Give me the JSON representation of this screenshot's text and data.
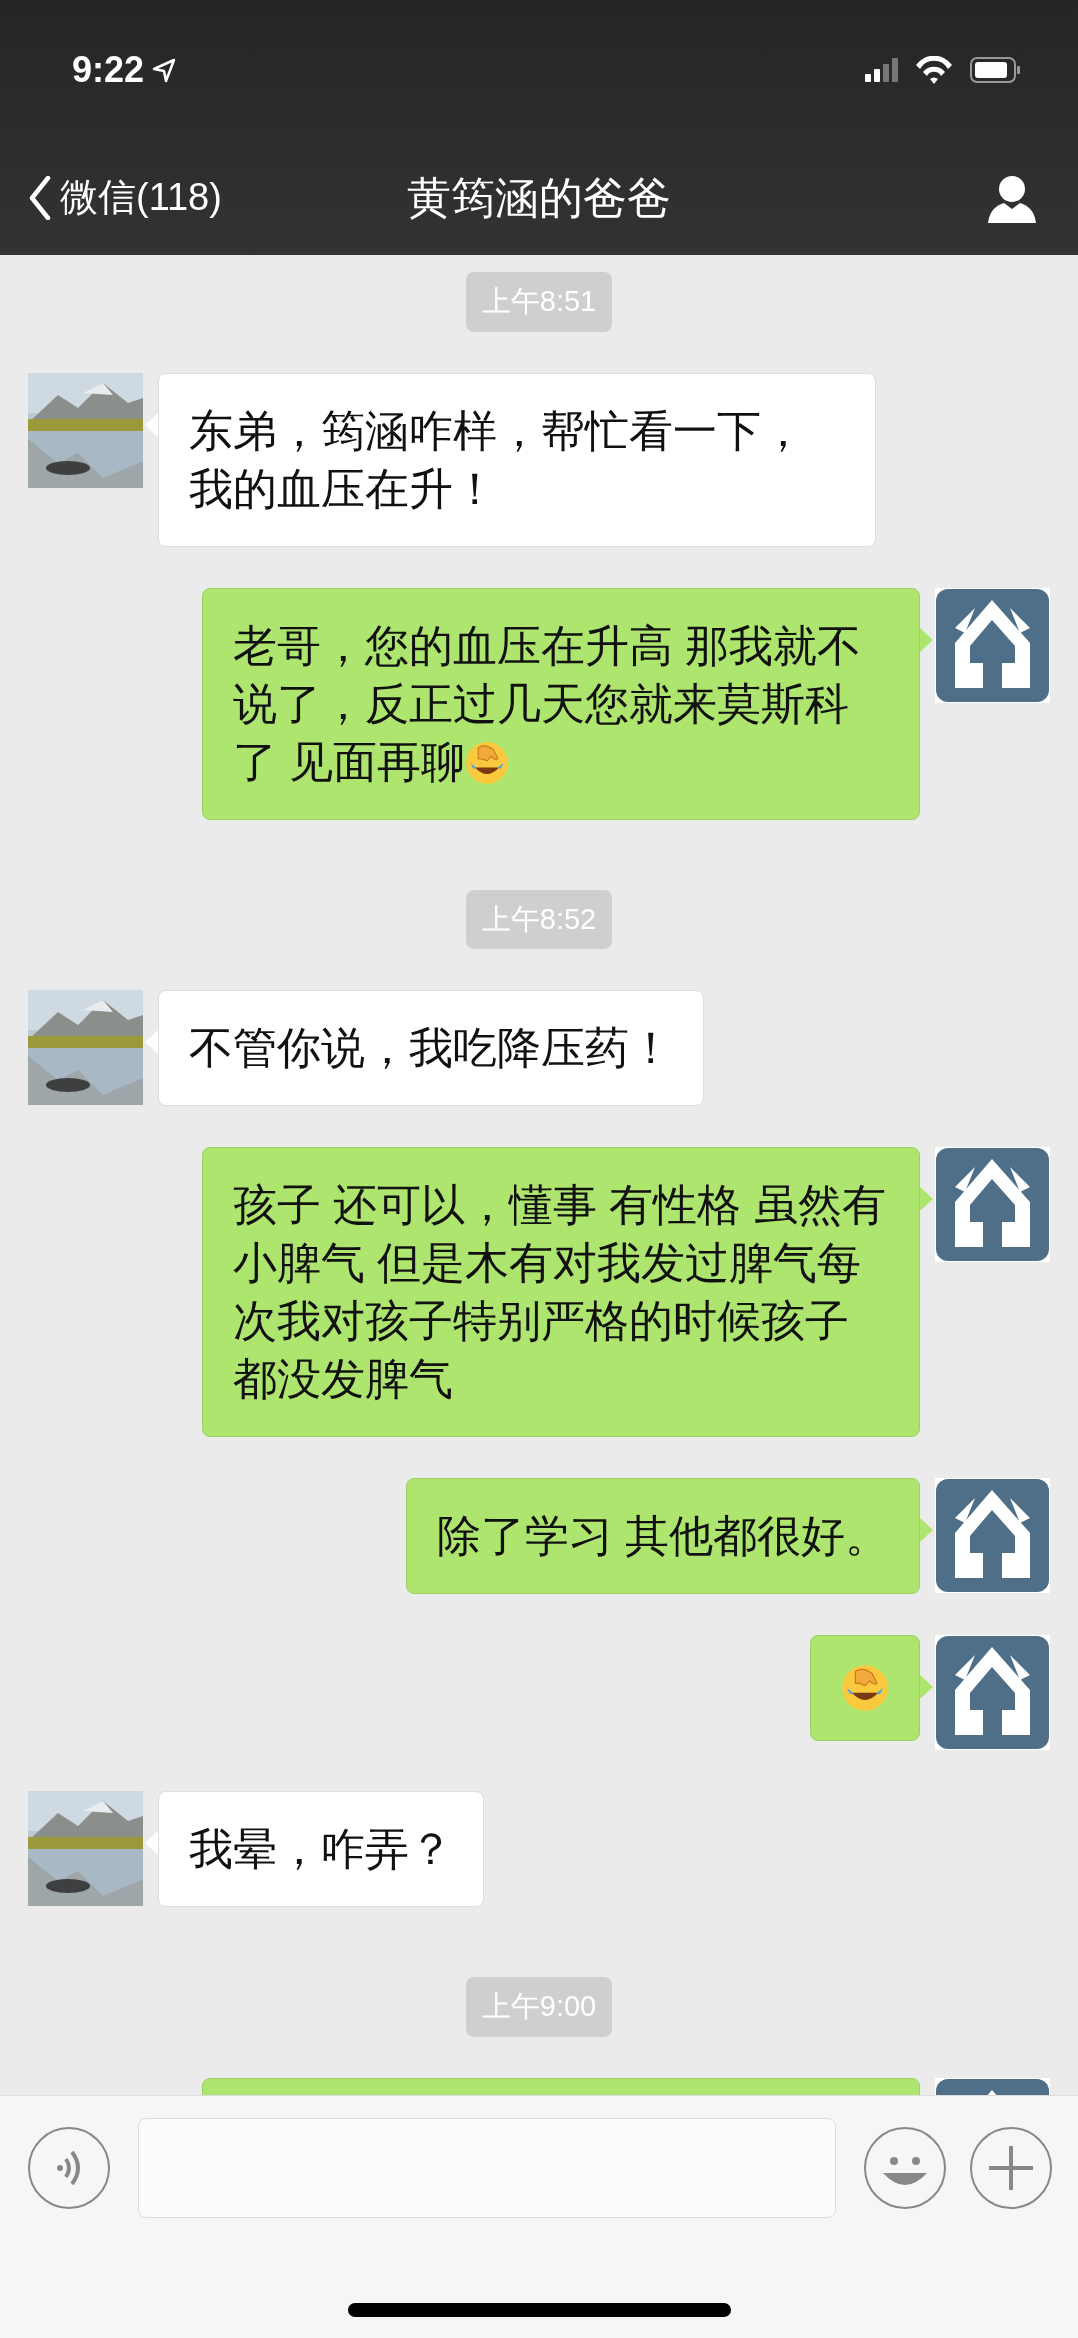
{
  "status_bar": {
    "time": "9:22"
  },
  "nav": {
    "back_label": "微信(118)",
    "title": "黄筠涵的爸爸"
  },
  "messages": [
    {
      "kind": "time",
      "text": "上午8:51"
    },
    {
      "kind": "text",
      "outgoing": false,
      "text": "东弟，筠涵咋样，帮忙看一下，我的血压在升！"
    },
    {
      "kind": "text",
      "outgoing": true,
      "text": "老哥，您的血压在升高 那我就不说了，反正过几天您就来莫斯科了 见面再聊",
      "trailing_emoji": true
    },
    {
      "kind": "time",
      "text": "上午8:52"
    },
    {
      "kind": "text",
      "outgoing": false,
      "text": "不管你说，我吃降压药！"
    },
    {
      "kind": "text",
      "outgoing": true,
      "text": "孩子 还可以，懂事 有性格 虽然有小脾气 但是木有对我发过脾气每次我对孩子特别严格的时候孩子都没发脾气"
    },
    {
      "kind": "text",
      "outgoing": true,
      "text": "除了学习 其他都很好。"
    },
    {
      "kind": "emoji",
      "outgoing": true
    },
    {
      "kind": "text",
      "outgoing": false,
      "text": "我晕，咋弄？"
    },
    {
      "kind": "time",
      "text": "上午9:00"
    },
    {
      "kind": "partial",
      "outgoing": true
    }
  ]
}
